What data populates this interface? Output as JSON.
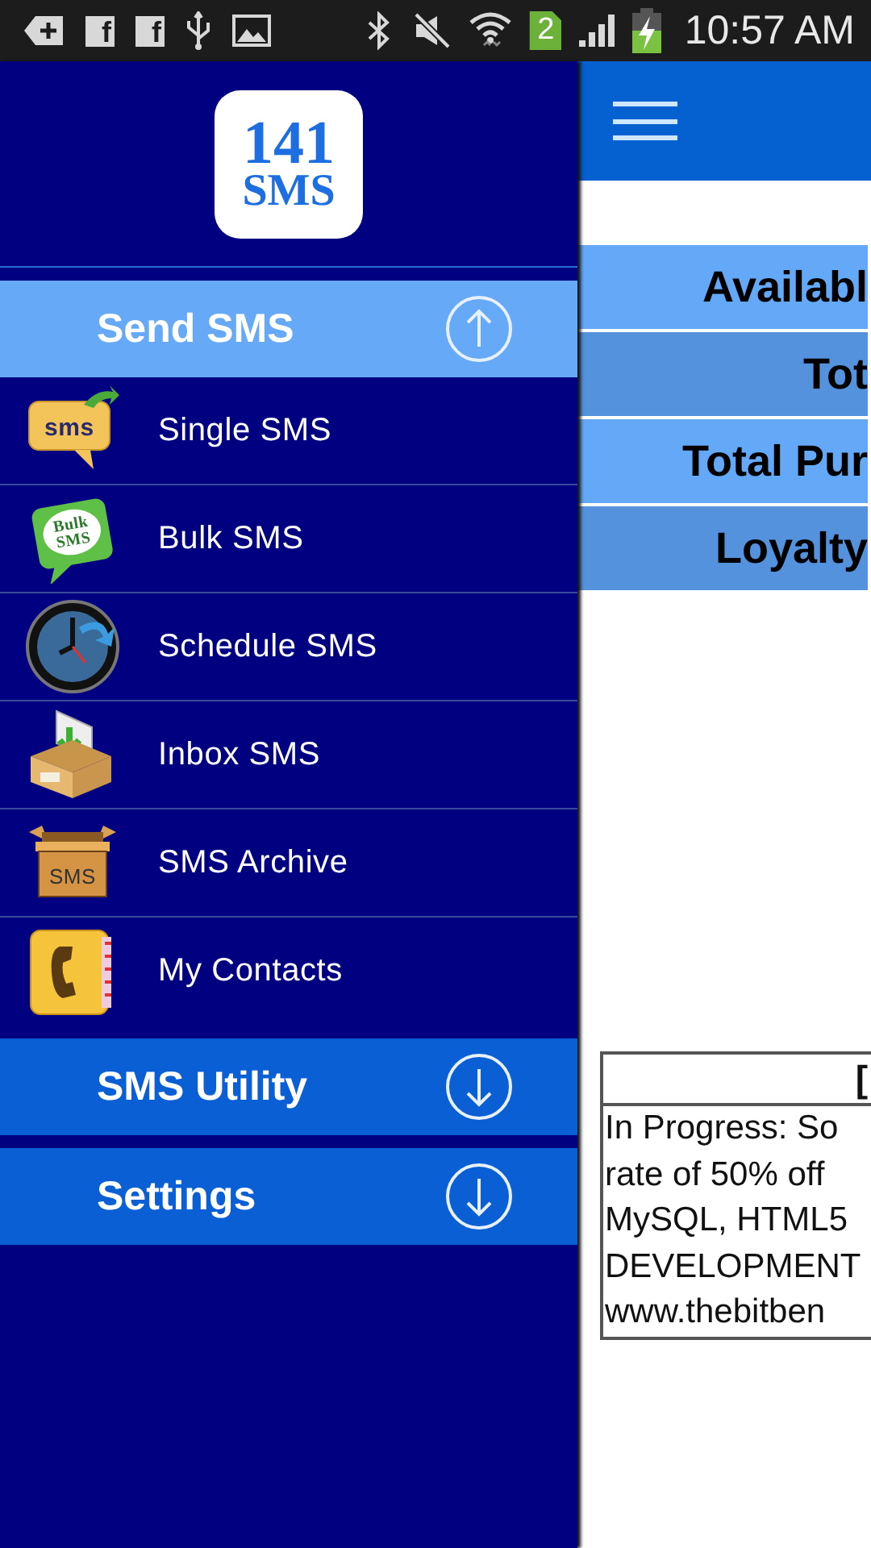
{
  "status_bar": {
    "notifications": [
      {
        "kind": "add"
      },
      {
        "kind": "facebook",
        "glyph": "f"
      },
      {
        "kind": "facebook",
        "glyph": "f"
      },
      {
        "kind": "usb"
      },
      {
        "kind": "image"
      }
    ],
    "system": [
      {
        "kind": "bluetooth"
      },
      {
        "kind": "mute"
      },
      {
        "kind": "wifi"
      },
      {
        "kind": "sim",
        "label": "2"
      },
      {
        "kind": "signal"
      },
      {
        "kind": "battery"
      }
    ],
    "time": "10:57 AM"
  },
  "drawer": {
    "logo": {
      "line1": "141",
      "line2": "SMS"
    },
    "sections": [
      {
        "title": "Send SMS",
        "expanded": true,
        "items": [
          {
            "label": "Single SMS",
            "kind": "sms-bubble",
            "icon_text": [
              "sms"
            ]
          },
          {
            "label": "Bulk SMS",
            "kind": "bulk-bubble",
            "icon_text": [
              "Bulk",
              "SMS"
            ]
          },
          {
            "label": "Schedule SMS",
            "kind": "clock"
          },
          {
            "label": "Inbox SMS",
            "kind": "inbox"
          },
          {
            "label": "SMS Archive",
            "kind": "archive",
            "icon_text": [
              "SMS"
            ]
          },
          {
            "label": "My Contacts",
            "kind": "contacts"
          }
        ]
      },
      {
        "title": "SMS Utility",
        "expanded": false
      },
      {
        "title": "Settings",
        "expanded": false
      }
    ]
  },
  "main": {
    "stat_rows": [
      "Availabl",
      "Tot",
      "Total Pur",
      "Loyalty"
    ],
    "notice": {
      "title": "[",
      "lines": [
        "In Progress: So",
        "rate of 50% off",
        "MySQL, HTML5",
        "DEVELOPMENT",
        "www.thebitben"
      ]
    }
  }
}
